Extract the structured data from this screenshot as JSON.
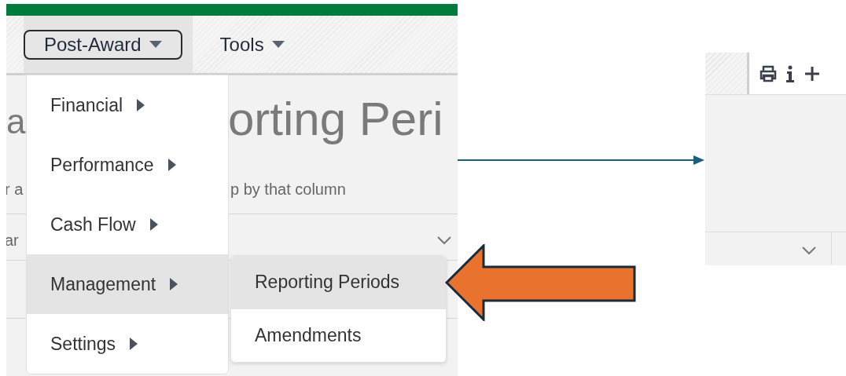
{
  "nav": {
    "menus": [
      {
        "label": "Post-Award",
        "selected": true
      },
      {
        "label": "Tools",
        "selected": false
      }
    ]
  },
  "background_page": {
    "title_fragments": [
      "a",
      "orting Peri"
    ],
    "hint_fragments": [
      "r a",
      "p by that column"
    ],
    "filter_fragment": "ar"
  },
  "menu": {
    "items": [
      {
        "label": "Financial",
        "selected": false
      },
      {
        "label": "Performance",
        "selected": false
      },
      {
        "label": "Cash Flow",
        "selected": false
      },
      {
        "label": "Management",
        "selected": true
      },
      {
        "label": "Settings",
        "selected": false
      }
    ]
  },
  "submenu": {
    "items": [
      {
        "label": "Reporting Periods",
        "selected": true
      },
      {
        "label": "Amendments",
        "selected": false
      }
    ]
  }
}
